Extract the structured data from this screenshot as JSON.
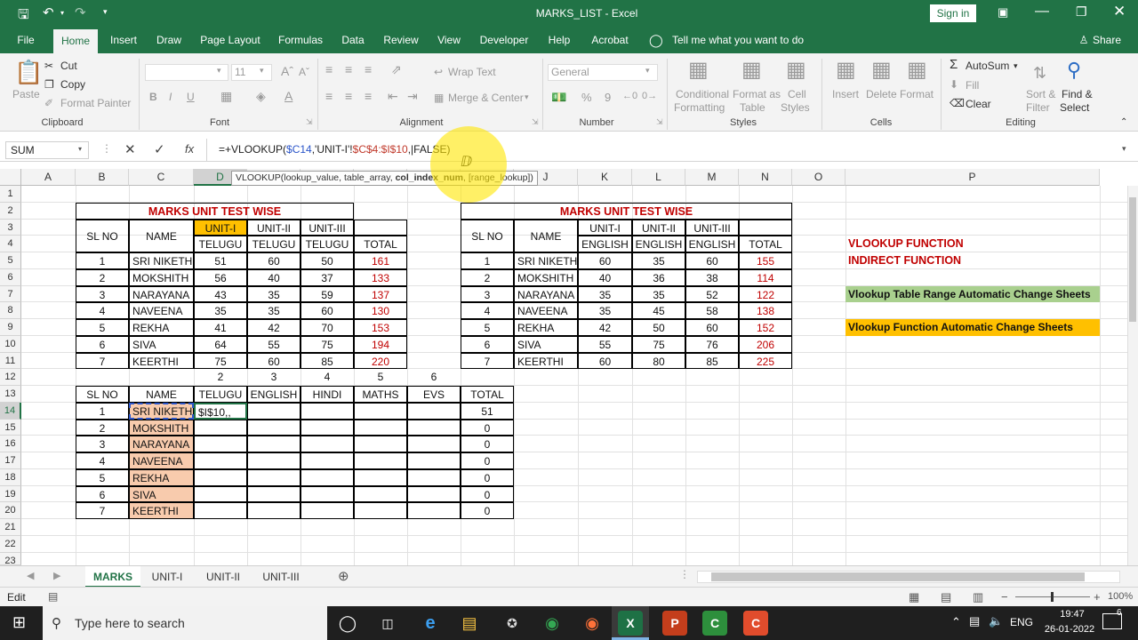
{
  "window": {
    "title": "MARKS_LIST  -  Excel",
    "signin": "Sign in",
    "quick_access": [
      "save-icon",
      "undo-icon",
      "redo-icon",
      "customize-icon"
    ]
  },
  "menu": {
    "tabs": [
      "File",
      "Home",
      "Insert",
      "Draw",
      "Page Layout",
      "Formulas",
      "Data",
      "Review",
      "View",
      "Developer",
      "Help",
      "Acrobat"
    ],
    "tell_me": "Tell me what you want to do",
    "share": "Share"
  },
  "ribbon": {
    "clipboard": {
      "paste": "Paste",
      "cut": "Cut",
      "copy": "Copy",
      "format_painter": "Format Painter",
      "group": "Clipboard"
    },
    "font": {
      "size": "11",
      "bold": "B",
      "italic": "I",
      "underline": "U",
      "group": "Font"
    },
    "alignment": {
      "wrap": "Wrap Text",
      "merge": "Merge & Center",
      "group": "Alignment"
    },
    "number": {
      "format": "General",
      "percent": "%",
      "comma": "9",
      "group": "Number"
    },
    "styles": {
      "conditional": "Conditional",
      "conditional2": "Formatting",
      "format_as": "Format as",
      "format_as2": "Table",
      "cell": "Cell",
      "cell2": "Styles",
      "group": "Styles"
    },
    "cells": {
      "insert": "Insert",
      "delete": "Delete",
      "format": "Format",
      "group": "Cells"
    },
    "editing": {
      "autosum": "AutoSum",
      "fill": "Fill",
      "clear": "Clear",
      "sort": "Sort &",
      "sort2": "Filter",
      "find": "Find &",
      "find2": "Select",
      "group": "Editing"
    }
  },
  "formula_bar": {
    "name_box": "SUM",
    "fx": "fx",
    "formula_prefix": "=+VLOOKUP(",
    "formula_ref1": "$C14",
    "formula_mid": ",'UNIT-I'!",
    "formula_ref2": "$C$4:$I$10",
    "formula_end": ",|FALSE)",
    "tooltip_func": "VLOOKUP(lookup_value, table_array, ",
    "tooltip_bold": "col_index_num",
    "tooltip_end": ", [range_lookup])"
  },
  "columns": [
    "A",
    "B",
    "C",
    "D",
    "E",
    "F",
    "G",
    "H",
    "I",
    "J",
    "K",
    "L",
    "M",
    "N",
    "O",
    "P"
  ],
  "rows": [
    "1",
    "2",
    "3",
    "4",
    "5",
    "6",
    "7",
    "8",
    "9",
    "10",
    "11",
    "12",
    "13",
    "14",
    "15",
    "16",
    "17",
    "18",
    "19",
    "20",
    "21",
    "22",
    "23"
  ],
  "table1": {
    "title": "MARKS  UNIT TEST WISE",
    "units": [
      "UNIT-I",
      "UNIT-II",
      "UNIT-III"
    ],
    "subject_headers": [
      "TELUGU",
      "TELUGU",
      "TELUGU",
      "TOTAL"
    ],
    "sl_header": "SL NO",
    "name_header": "NAME",
    "rows": [
      [
        "1",
        "SRI NIKETH",
        "51",
        "60",
        "50",
        "161"
      ],
      [
        "2",
        "MOKSHITH",
        "56",
        "40",
        "37",
        "133"
      ],
      [
        "3",
        "NARAYANA",
        "43",
        "35",
        "59",
        "137"
      ],
      [
        "4",
        "NAVEENA",
        "35",
        "35",
        "60",
        "130"
      ],
      [
        "5",
        "REKHA",
        "41",
        "42",
        "70",
        "153"
      ],
      [
        "6",
        "SIVA",
        "64",
        "55",
        "75",
        "194"
      ],
      [
        "7",
        "KEERTHI",
        "75",
        "60",
        "85",
        "220"
      ]
    ]
  },
  "table2": {
    "title": "MARKS  UNIT TEST WISE",
    "units": [
      "UNIT-I",
      "UNIT-II",
      "UNIT-III"
    ],
    "subject_headers": [
      "ENGLISH",
      "ENGLISH",
      "ENGLISH",
      "TOTAL"
    ],
    "sl_header": "SL NO",
    "name_header": "NAME",
    "rows": [
      [
        "1",
        "SRI NIKETH",
        "60",
        "35",
        "60",
        "155"
      ],
      [
        "2",
        "MOKSHITH",
        "40",
        "36",
        "38",
        "114"
      ],
      [
        "3",
        "NARAYANA",
        "35",
        "35",
        "52",
        "122"
      ],
      [
        "4",
        "NAVEENA",
        "35",
        "45",
        "58",
        "138"
      ],
      [
        "5",
        "REKHA",
        "42",
        "50",
        "60",
        "152"
      ],
      [
        "6",
        "SIVA",
        "55",
        "75",
        "76",
        "206"
      ],
      [
        "7",
        "KEERTHI",
        "60",
        "80",
        "85",
        "225"
      ]
    ]
  },
  "table3": {
    "index_numbers": [
      "2",
      "3",
      "4",
      "5",
      "6"
    ],
    "headers": [
      "SL NO",
      "NAME",
      "TELUGU",
      "ENGLISH",
      "HINDI",
      "MATHS",
      "EVS",
      "TOTAL"
    ],
    "editing_value": "$I$10,,",
    "rows": [
      [
        "1",
        "SRI NIKETH",
        "51"
      ],
      [
        "2",
        "MOKSHITH",
        "0"
      ],
      [
        "3",
        "NARAYANA",
        "0"
      ],
      [
        "4",
        "NAVEENA",
        "0"
      ],
      [
        "5",
        "REKHA",
        "0"
      ],
      [
        "6",
        "SIVA",
        "0"
      ],
      [
        "7",
        "KEERTHI",
        "0"
      ]
    ]
  },
  "notes": {
    "vlookup": "VLOOKUP FUNCTION",
    "indirect": "INDIRECT FUNCTION",
    "range_change": "Vlookup Table Range Automatic Change Sheets",
    "function_change": "Vlookup Function Automatic Change Sheets",
    "range_color": "#a9d08e",
    "function_color": "#ffc000"
  },
  "sheets": [
    "MARKS",
    "UNIT-I",
    "UNIT-II",
    "UNIT-III"
  ],
  "status": {
    "mode": "Edit",
    "zoom": "100%"
  },
  "taskbar": {
    "search": "Type here to search",
    "lang": "ENG",
    "time": "19:47",
    "date": "26-01-2022",
    "notifications": "6"
  }
}
